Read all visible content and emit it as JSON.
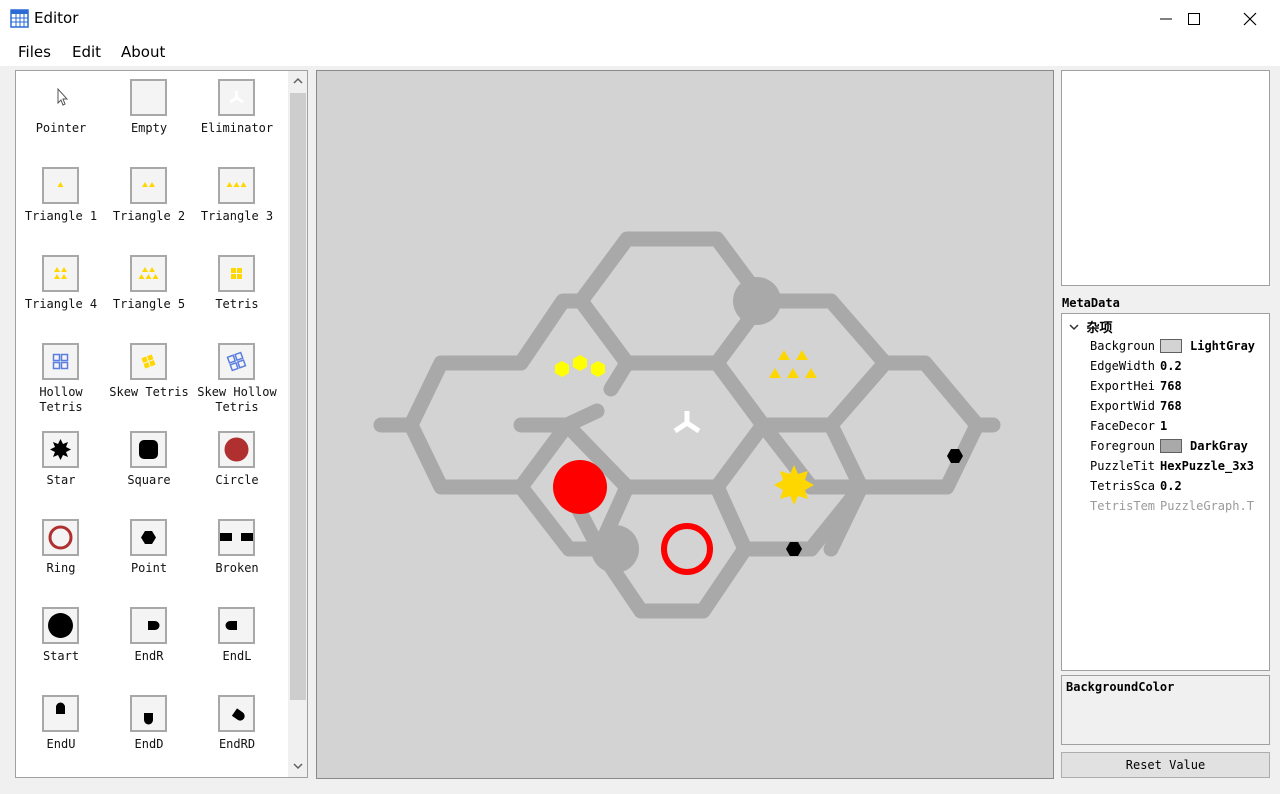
{
  "window": {
    "title": "Editor"
  },
  "menu": [
    "Files",
    "Edit",
    "About"
  ],
  "toolbox": {
    "items": [
      {
        "label": "Pointer",
        "icon": "pointer-icon"
      },
      {
        "label": "Empty",
        "icon": "empty-icon"
      },
      {
        "label": "Eliminator",
        "icon": "eliminator-icon"
      },
      {
        "label": "Triangle 1",
        "icon": "triangle-1-icon"
      },
      {
        "label": "Triangle 2",
        "icon": "triangle-2-icon"
      },
      {
        "label": "Triangle 3",
        "icon": "triangle-3-icon"
      },
      {
        "label": "Triangle 4",
        "icon": "triangle-4-icon"
      },
      {
        "label": "Triangle 5",
        "icon": "triangle-5-icon"
      },
      {
        "label": "Tetris",
        "icon": "tetris-icon"
      },
      {
        "label": "Hollow\nTetris",
        "icon": "hollow-tetris-icon"
      },
      {
        "label": "Skew Tetris",
        "icon": "skew-tetris-icon"
      },
      {
        "label": "Skew Hollow\nTetris",
        "icon": "skew-hollow-tetris-icon"
      },
      {
        "label": "Star",
        "icon": "star-icon"
      },
      {
        "label": "Square",
        "icon": "square-icon"
      },
      {
        "label": "Circle",
        "icon": "circle-icon"
      },
      {
        "label": "Ring",
        "icon": "ring-icon"
      },
      {
        "label": "Point",
        "icon": "point-icon"
      },
      {
        "label": "Broken",
        "icon": "broken-icon"
      },
      {
        "label": "Start",
        "icon": "start-icon"
      },
      {
        "label": "EndR",
        "icon": "end-right-icon"
      },
      {
        "label": "EndL",
        "icon": "end-left-icon"
      },
      {
        "label": "EndU",
        "icon": "end-up-icon"
      },
      {
        "label": "EndD",
        "icon": "end-down-icon"
      },
      {
        "label": "EndRD",
        "icon": "end-right-down-icon"
      }
    ]
  },
  "puzzle": {
    "background_color": "#d3d3d3",
    "edge_color": "#a9a9a9",
    "yellow": "#ffd700",
    "red": "#ff0000"
  },
  "metadata": {
    "title": "MetaData",
    "category": "杂项",
    "properties": [
      {
        "name": "Backgroun",
        "value": "LightGray",
        "swatch": "#d3d3d3"
      },
      {
        "name": "EdgeWidth",
        "value": "0.2"
      },
      {
        "name": "ExportHei",
        "value": "768"
      },
      {
        "name": "ExportWid",
        "value": "768"
      },
      {
        "name": "FaceDecor",
        "value": "1"
      },
      {
        "name": "Foregroun",
        "value": "DarkGray",
        "swatch": "#a9a9a9"
      },
      {
        "name": "PuzzleTit",
        "value": "HexPuzzle_3x3"
      },
      {
        "name": "TetrisSca",
        "value": "0.2"
      },
      {
        "name": "TetrisTem",
        "value": "PuzzleGraph.T",
        "dim": true
      }
    ]
  },
  "description": {
    "title": "BackgroundColor"
  },
  "reset_button": "Reset Value"
}
